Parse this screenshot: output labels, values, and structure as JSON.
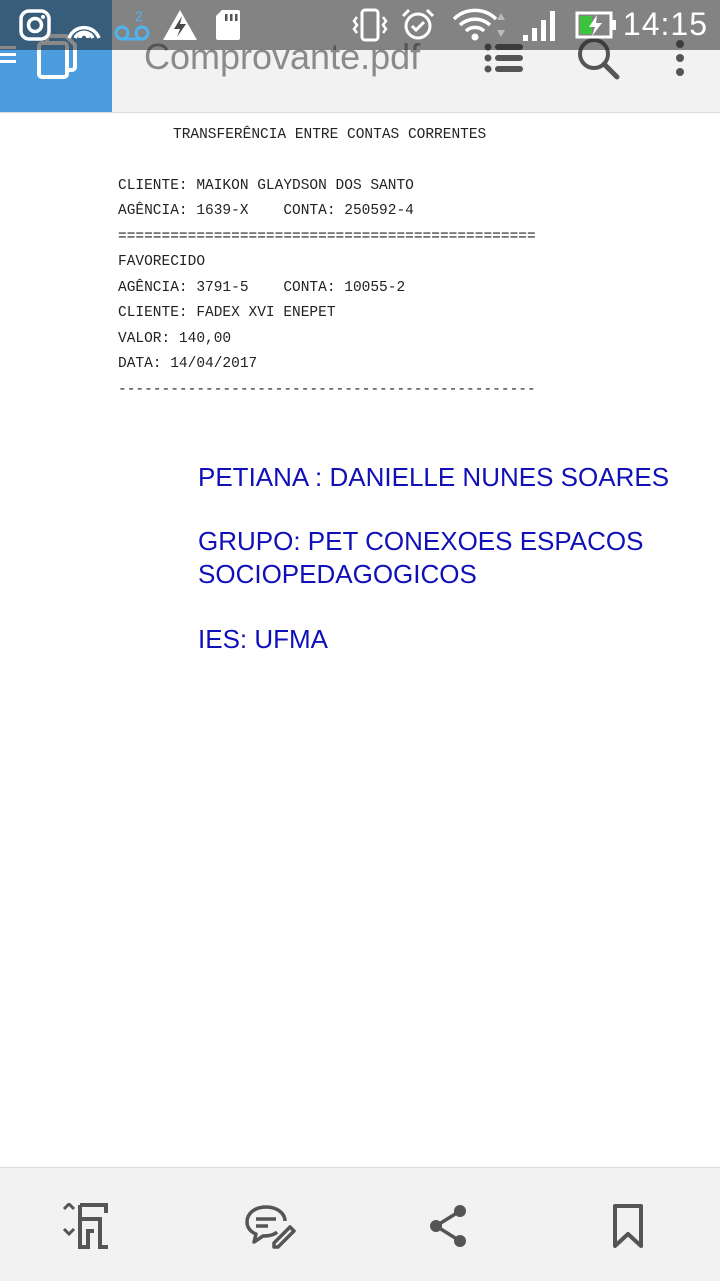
{
  "status_bar": {
    "time": "14:15",
    "icons": [
      "instagram-icon",
      "hotspot-icon",
      "voicemail-icon",
      "warning-icon",
      "sd-card-icon",
      "vibrate-icon",
      "alarm-icon",
      "wifi-icon",
      "signal-icon",
      "battery-charging-icon"
    ],
    "battery_color": "#3cc43c"
  },
  "app_bar": {
    "title": "Comprovante.pdf",
    "accent_color": "#4b9de0",
    "icons": [
      "menu-icon",
      "document-pages-icon",
      "list-icon",
      "search-icon",
      "more-vert-icon"
    ]
  },
  "document": {
    "receipt": {
      "heading": "TRANSFERÊNCIA ENTRE CONTAS CORRENTES",
      "client_line": "CLIENTE: MAIKON GLAYDSON DOS SANTO",
      "agency_line": "AGÊNCIA: 1639-X    CONTA: 250592-4",
      "separator_double": "================================================",
      "favorecido_label": "FAVORECIDO",
      "fav_agency_line": "AGÊNCIA: 3791-5    CONTA: 10055-2",
      "fav_client_line": "CLIENTE: FADEX XVI ENEPET",
      "value_line": "VALOR: 140,00",
      "date_line": "DATA: 14/04/2017",
      "separator_dashed": "------------------------------------------------"
    },
    "annotation": {
      "color": "#1010b8",
      "petiana": "PETIANA : DANIELLE NUNES SOARES",
      "grupo": "GRUPO: PET CONEXOES ESPACOS SOCIOPEDAGOGICOS",
      "ies": "IES: UFMA"
    }
  },
  "bottom_bar": {
    "icons": [
      "reflow-icon",
      "comment-edit-icon",
      "share-icon",
      "bookmark-icon"
    ]
  }
}
